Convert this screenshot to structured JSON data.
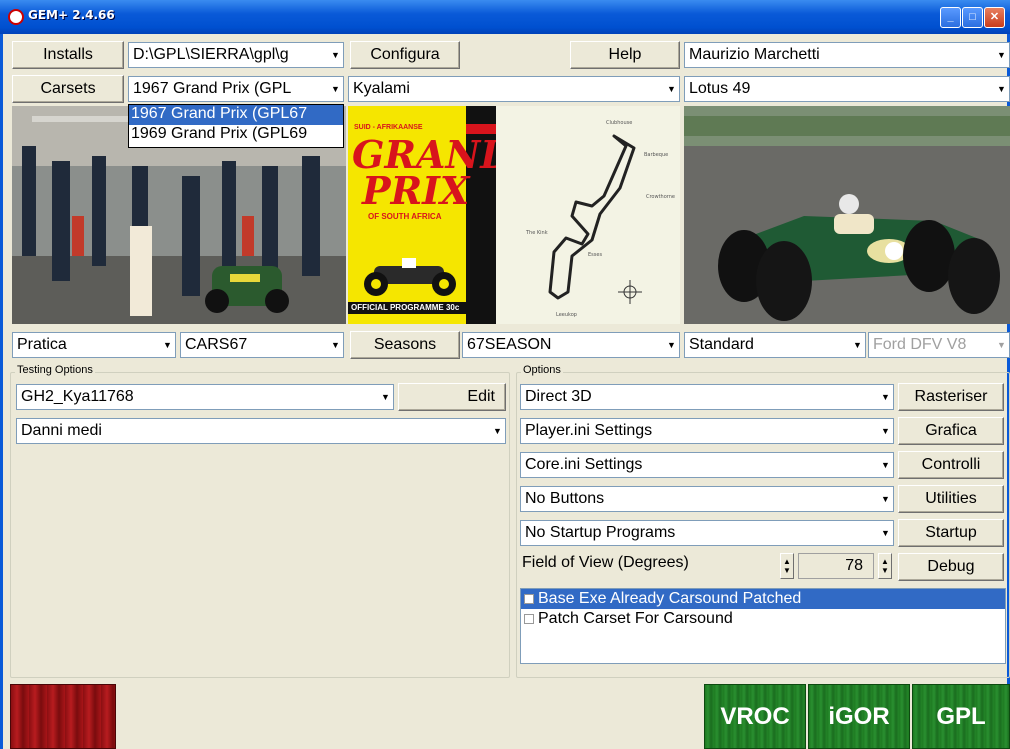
{
  "window": {
    "title": "GEM+ 2.4.66"
  },
  "row1": {
    "installs_label": "Installs",
    "installs_path": "D:\\GPL\\SIERRA\\gpl\\g",
    "configura_label": "Configura",
    "help_label": "Help",
    "driver": "Maurizio Marchetti"
  },
  "row2": {
    "carsets_label": "Carsets",
    "carset": "1967 Grand Prix (GPL",
    "track": "Kyalami",
    "car": "Lotus 49"
  },
  "carset_dropdown": {
    "options": [
      "1967 Grand Prix (GPL67",
      "1969 Grand Prix (GPL69"
    ],
    "selected_index": 0
  },
  "poster": {
    "header": "SUID - AFRIKAANSE",
    "line1": "GRAND",
    "line2": "PRIX",
    "subtitle": "OF SOUTH AFRICA",
    "footer": "OFFICIAL PROGRAMME 30c"
  },
  "row3": {
    "session": "Pratica",
    "cars": "CARS67",
    "seasons_label": "Seasons",
    "season": "67SEASON",
    "setup": "Standard",
    "engine": "Ford DFV V8"
  },
  "testing": {
    "group_label": "Testing Options",
    "profile": "GH2_Kya11768",
    "edit_label": "Edit",
    "damage": "Danni medi"
  },
  "options": {
    "group_label": "Options",
    "renderer": "Direct 3D",
    "rasteriser_label": "Rasteriser",
    "player_ini": "Player.ini Settings",
    "grafica_label": "Grafica",
    "core_ini": "Core.ini Settings",
    "controlli_label": "Controlli",
    "buttons": "No Buttons",
    "utilities_label": "Utilities",
    "startup_programs": "No Startup Programs",
    "startup_label": "Startup",
    "fov_label": "Field of View (Degrees)",
    "fov_value": "78",
    "debug_label": "Debug",
    "checklist": [
      {
        "label": "Base Exe Already Carsound Patched",
        "checked": false,
        "selected": true
      },
      {
        "label": "Patch Carset For Carsound",
        "checked": false,
        "selected": false
      }
    ]
  },
  "launch": {
    "vroc_label": "VROC",
    "igor_label": "iGOR",
    "gpl_label": "GPL"
  },
  "colors": {
    "title_bar": "#0a5ad8",
    "selection": "#316ac5",
    "launch_green": "#1e7a22",
    "poster_yellow": "#f5e600",
    "poster_red": "#d8141c"
  }
}
